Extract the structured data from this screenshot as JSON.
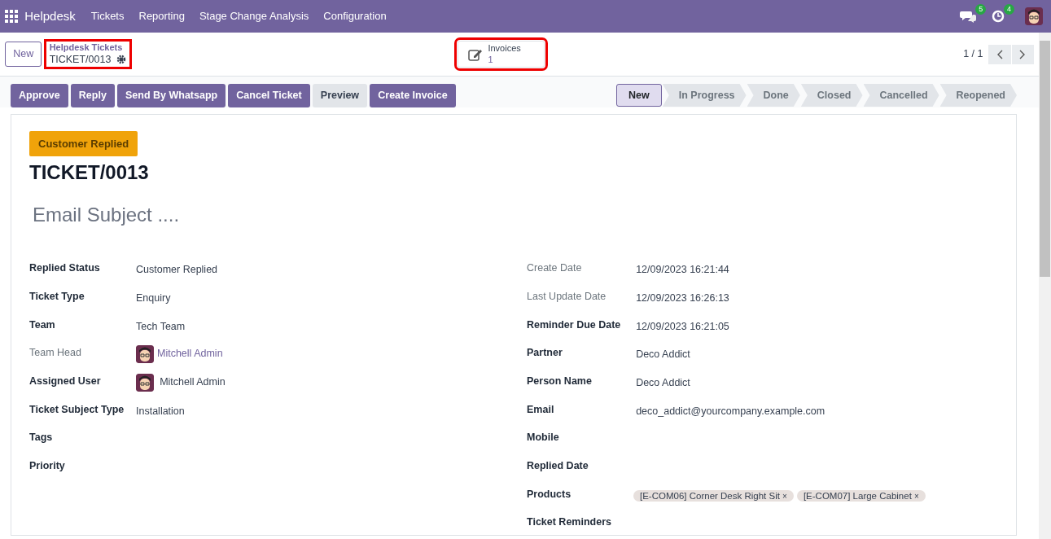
{
  "navbar": {
    "app": "Helpdesk",
    "menu": [
      "Tickets",
      "Reporting",
      "Stage Change Analysis",
      "Configuration"
    ],
    "messages_count": "5",
    "activities_count": "4"
  },
  "control_panel": {
    "new_button": "New",
    "breadcrumb": {
      "parent": "Helpdesk Tickets",
      "current": "TICKET/0013",
      "highlighted": true
    },
    "smart_button": {
      "label": "Invoices",
      "value": "1",
      "highlighted": true
    },
    "pager": "1 / 1"
  },
  "actions": [
    {
      "label": "Approve",
      "kind": "primary"
    },
    {
      "label": "Reply",
      "kind": "primary"
    },
    {
      "label": "Send By Whatsapp",
      "kind": "primary"
    },
    {
      "label": "Cancel Ticket",
      "kind": "primary"
    },
    {
      "label": "Preview",
      "kind": "secondary"
    },
    {
      "label": "Create Invoice",
      "kind": "primary"
    }
  ],
  "stages": [
    {
      "label": "New",
      "selected": true
    },
    {
      "label": "In Progress",
      "selected": false
    },
    {
      "label": "Done",
      "selected": false
    },
    {
      "label": "Closed",
      "selected": false
    },
    {
      "label": "Cancelled",
      "selected": false
    },
    {
      "label": "Reopened",
      "selected": false
    }
  ],
  "sheet": {
    "ribbon": "Customer Replied",
    "title": "TICKET/0013",
    "subject_placeholder": "Email Subject ....",
    "left_fields": [
      {
        "label": "Replied Status",
        "muted": false,
        "kind": "text",
        "value": "Customer Replied"
      },
      {
        "label": "Ticket Type",
        "muted": false,
        "kind": "text",
        "value": "Enquiry"
      },
      {
        "label": "Team",
        "muted": false,
        "kind": "text",
        "value": "Tech Team"
      },
      {
        "label": "Team Head",
        "muted": true,
        "kind": "user-link",
        "value": "Mitchell Admin"
      },
      {
        "label": "Assigned User",
        "muted": false,
        "kind": "user",
        "value": "Mitchell Admin"
      },
      {
        "label": "Ticket Subject Type",
        "muted": false,
        "kind": "text",
        "value": "Installation"
      },
      {
        "label": "Tags",
        "muted": false,
        "kind": "text"
      },
      {
        "label": "Priority",
        "muted": false,
        "kind": "text"
      }
    ],
    "right_fields": [
      {
        "label": "Create Date",
        "muted": true,
        "kind": "text",
        "value": "12/09/2023 16:21:44"
      },
      {
        "label": "Last Update Date",
        "muted": true,
        "kind": "text",
        "value": "12/09/2023 16:26:13"
      },
      {
        "label": "Reminder Due Date",
        "muted": false,
        "kind": "text",
        "value": "12/09/2023 16:21:05"
      },
      {
        "label": "Partner",
        "muted": false,
        "kind": "text",
        "value": "Deco Addict"
      },
      {
        "label": "Person Name",
        "muted": false,
        "kind": "text",
        "value": "Deco Addict"
      },
      {
        "label": "Email",
        "muted": false,
        "kind": "text",
        "value": "deco_addict@yourcompany.example.com"
      },
      {
        "label": "Mobile",
        "muted": false,
        "kind": "text"
      },
      {
        "label": "Replied Date",
        "muted": false,
        "kind": "text"
      },
      {
        "label": "Products",
        "muted": false,
        "kind": "tags",
        "tags": [
          "[E-COM06] Corner Desk Right Sit",
          "[E-COM07] Large Cabinet"
        ],
        "remove": "×"
      },
      {
        "label": "Ticket Reminders",
        "muted": false,
        "kind": "text"
      }
    ]
  }
}
